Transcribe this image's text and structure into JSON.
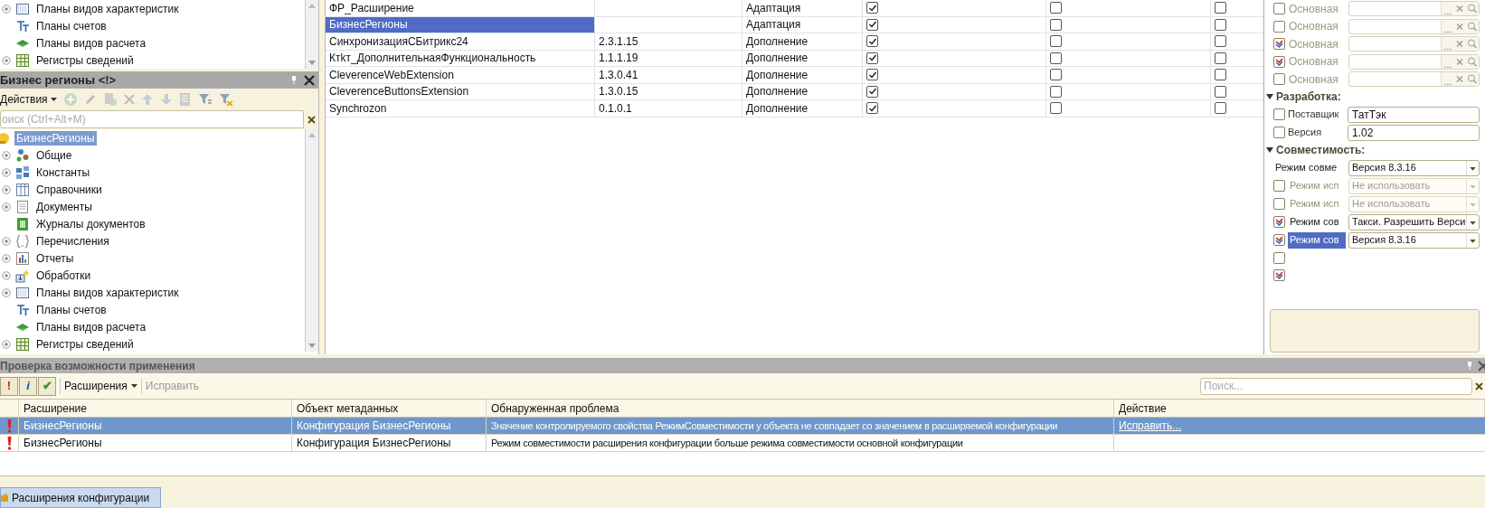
{
  "top_tree": [
    {
      "label": "Планы видов характеристик",
      "kind": "charts_of_characteristics",
      "expandable": true
    },
    {
      "label": "Планы счетов",
      "kind": "charts_of_accounts",
      "expandable": false
    },
    {
      "label": "Планы видов расчета",
      "kind": "charts_of_calculation",
      "expandable": false
    },
    {
      "label": "Регистры сведений",
      "kind": "info_registers",
      "expandable": true
    }
  ],
  "config_panel": {
    "title": "Бизнес регионы <!>",
    "actions_label": "Действия",
    "search_placeholder": "оиск (Ctrl+Alt+M)",
    "root": {
      "label": "БизнесРегионы",
      "selected": true
    },
    "tree": [
      {
        "label": "Общие",
        "kind": "common",
        "expandable": true
      },
      {
        "label": "Константы",
        "kind": "constants",
        "expandable": true
      },
      {
        "label": "Справочники",
        "kind": "catalogs",
        "expandable": true
      },
      {
        "label": "Документы",
        "kind": "documents",
        "expandable": true
      },
      {
        "label": "Журналы документов",
        "kind": "journals",
        "expandable": false
      },
      {
        "label": "Перечисления",
        "kind": "enums",
        "expandable": true
      },
      {
        "label": "Отчеты",
        "kind": "reports",
        "expandable": true
      },
      {
        "label": "Обработки",
        "kind": "processors",
        "expandable": true
      },
      {
        "label": "Планы видов характеристик",
        "kind": "charts_of_characteristics",
        "expandable": true
      },
      {
        "label": "Планы счетов",
        "kind": "charts_of_accounts",
        "expandable": false
      },
      {
        "label": "Планы видов расчета",
        "kind": "charts_of_calculation",
        "expandable": false
      },
      {
        "label": "Регистры сведений",
        "kind": "info_registers",
        "expandable": true
      }
    ]
  },
  "extensions": [
    {
      "name": "ФР_Расширение",
      "purpose": "Адаптация",
      "column_4": true,
      "column_5": false,
      "column_6": false,
      "selected": false
    },
    {
      "name": "БизнесРегионы",
      "purpose": "Адаптация",
      "column_4": true,
      "column_5": false,
      "column_6": false,
      "selected": true
    },
    {
      "name": "СинхронизацияСБитрикс24",
      "version": "2.3.1.15",
      "purpose": "Дополнение",
      "column_4": true,
      "column_5": false,
      "column_6": false,
      "selected": false
    },
    {
      "name": "Ктkт_ДополнительнаяФункциональность",
      "version": "1.1.1.19",
      "purpose": "Дополнение",
      "column_4": true,
      "column_5": false,
      "column_6": false,
      "selected": false
    },
    {
      "name": "CleverenceWebExtension",
      "version": "1.3.0.41",
      "purpose": "Дополнение",
      "column_4": true,
      "column_5": false,
      "column_6": false,
      "selected": false
    },
    {
      "name": "CleverenceButtonsExtension",
      "version": "1.3.0.15",
      "purpose": "Дополнение",
      "column_4": true,
      "column_5": false,
      "column_6": false,
      "selected": false
    },
    {
      "name": "Synchrozon",
      "version": "0.1.0.1",
      "purpose": "Дополнение",
      "column_4": true,
      "column_5": false,
      "column_6": false,
      "selected": false
    }
  ],
  "properties": [
    {
      "kind": "base_form",
      "label": "Основная",
      "checked": false
    },
    {
      "kind": "base_form",
      "label": "Основная",
      "checked": false
    },
    {
      "kind": "base_form",
      "label": "Основная",
      "checked": true
    },
    {
      "kind": "base_form",
      "label": "Основная",
      "checked": true
    },
    {
      "kind": "base_form",
      "label": "Основная",
      "checked": false
    },
    {
      "kind": "section",
      "label": "Разработка:",
      "expanded": true
    },
    {
      "kind": "text",
      "label": "Поставщик",
      "value": "ТатТэк",
      "checked": false
    },
    {
      "kind": "text",
      "label": "Версия",
      "value": "1.02",
      "checked": false
    },
    {
      "kind": "section",
      "label": "Совместимость:",
      "expanded": true
    },
    {
      "kind": "select",
      "label": "Режим совме",
      "value": "Версия 8.3.16",
      "disabled": false,
      "selected": false
    },
    {
      "kind": "select",
      "label": "Режим исп",
      "value": "Не использовать",
      "disabled": true,
      "checked": false,
      "selected": false
    },
    {
      "kind": "select",
      "label": "Режим исп",
      "value": "Не использовать",
      "disabled": true,
      "checked": false,
      "selected": false
    },
    {
      "kind": "select",
      "label": "Режим сов",
      "value": "Такси. Разрешить Верси",
      "disabled": false,
      "checked": true,
      "selected": false
    },
    {
      "kind": "select",
      "label": "Режим сов",
      "value": "Версия 8.3.16",
      "disabled": false,
      "checked": true,
      "selected": true
    },
    {
      "kind": "checkbox",
      "checked": false
    },
    {
      "kind": "checkbox",
      "checked": true
    }
  ],
  "check_panel": {
    "title": "Проверка возможности применения",
    "filters": [
      {
        "symbol": "!",
        "kind": "error",
        "on": true
      },
      {
        "symbol": "i",
        "kind": "info",
        "on": true
      },
      {
        "symbol": "✔",
        "kind": "ok",
        "on": true
      }
    ],
    "extensions_menu": "Расширения",
    "fix_button": {
      "label": "Исправить",
      "disabled": true
    },
    "search_placeholder": "Поиск...",
    "columns": [
      "Расширение",
      "Объект метаданных",
      "Обнаруженная проблема",
      "Действие"
    ],
    "rows": [
      {
        "extension": "БизнесРегионы",
        "object": "Конфигурация БизнесРегионы",
        "problem": "Значение контролируемого свойства РежимСовместимости у объекта  не совпадает со значением в расширяемой конфигурации",
        "action": "Исправить...",
        "selected": true
      },
      {
        "extension": "БизнесРегионы",
        "object": "Конфигурация БизнесРегионы",
        "problem": "Режим совместимости расширения конфигурации больше режима совместимости основной конфигурации",
        "selected": false
      }
    ]
  },
  "bottom_tab": {
    "label": "Расширения конфигурации"
  }
}
